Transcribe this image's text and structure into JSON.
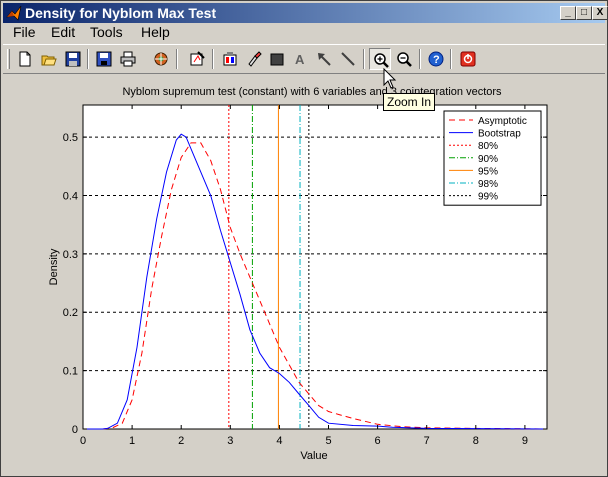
{
  "window": {
    "title": "Density for Nyblom Max Test",
    "controls": {
      "minimize": "_",
      "maximize": "□",
      "close": "X"
    }
  },
  "menu": [
    "File",
    "Edit",
    "Tools",
    "Help"
  ],
  "toolbar": {
    "tools": [
      {
        "name": "new-figure-icon"
      },
      {
        "name": "open-file-icon"
      },
      {
        "name": "save-icon"
      },
      {
        "name": "save-disk-icon"
      },
      {
        "name": "print-icon"
      },
      {
        "name": "plot-tools-icon"
      },
      {
        "name": "edit-plot-icon"
      },
      {
        "name": "insert-colorbar-icon"
      },
      {
        "name": "brush-icon"
      },
      {
        "name": "rectangle-icon"
      },
      {
        "name": "text-a-icon"
      },
      {
        "name": "arrow-icon"
      },
      {
        "name": "line-icon"
      },
      {
        "name": "zoom-in-icon"
      },
      {
        "name": "zoom-out-icon"
      },
      {
        "name": "help-icon"
      },
      {
        "name": "stop-icon"
      }
    ],
    "text_tool_glyph": "A",
    "tooltip": "Zoom In"
  },
  "chart_data": {
    "type": "line",
    "title": "Nyblom supremum test (constant) with 6 variables and 3 cointegration vectors",
    "xlabel": "Value",
    "ylabel": "Density",
    "xlim": [
      0,
      9.45
    ],
    "ylim": [
      0,
      0.555
    ],
    "xticks": [
      0,
      1,
      2,
      3,
      4,
      5,
      6,
      7,
      8,
      9
    ],
    "yticks": [
      0,
      0.1,
      0.2,
      0.3,
      0.4,
      0.5
    ],
    "grid": "y",
    "legend_position": "top-right",
    "series": [
      {
        "name": "Asymptotic",
        "color": "#ff0000",
        "dash": "dashed",
        "points": [
          [
            0,
            0
          ],
          [
            0.4,
            0
          ],
          [
            0.6,
            0.002
          ],
          [
            0.8,
            0.01
          ],
          [
            1.0,
            0.05
          ],
          [
            1.2,
            0.13
          ],
          [
            1.4,
            0.24
          ],
          [
            1.6,
            0.33
          ],
          [
            1.8,
            0.41
          ],
          [
            2.0,
            0.465
          ],
          [
            2.2,
            0.49
          ],
          [
            2.4,
            0.49
          ],
          [
            2.6,
            0.46
          ],
          [
            2.8,
            0.41
          ],
          [
            3.0,
            0.345
          ],
          [
            3.2,
            0.3
          ],
          [
            3.4,
            0.26
          ],
          [
            3.6,
            0.22
          ],
          [
            3.8,
            0.18
          ],
          [
            4.0,
            0.14
          ],
          [
            4.2,
            0.11
          ],
          [
            4.4,
            0.08
          ],
          [
            4.6,
            0.06
          ],
          [
            4.8,
            0.04
          ],
          [
            5.0,
            0.03
          ],
          [
            5.2,
            0.025
          ],
          [
            5.5,
            0.018
          ],
          [
            6.0,
            0.008
          ],
          [
            6.5,
            0.004
          ],
          [
            7.0,
            0.002
          ],
          [
            8.0,
            0.001
          ],
          [
            9.45,
            0
          ]
        ]
      },
      {
        "name": "Bootstrap",
        "color": "#0000ff",
        "dash": "solid",
        "points": [
          [
            0,
            0
          ],
          [
            0.4,
            0
          ],
          [
            0.5,
            0.001
          ],
          [
            0.7,
            0.01
          ],
          [
            0.9,
            0.05
          ],
          [
            1.1,
            0.14
          ],
          [
            1.3,
            0.26
          ],
          [
            1.5,
            0.36
          ],
          [
            1.7,
            0.44
          ],
          [
            1.9,
            0.495
          ],
          [
            2.0,
            0.505
          ],
          [
            2.1,
            0.5
          ],
          [
            2.2,
            0.48
          ],
          [
            2.4,
            0.44
          ],
          [
            2.6,
            0.4
          ],
          [
            2.8,
            0.34
          ],
          [
            3.0,
            0.285
          ],
          [
            3.2,
            0.23
          ],
          [
            3.4,
            0.17
          ],
          [
            3.6,
            0.13
          ],
          [
            3.8,
            0.105
          ],
          [
            4.0,
            0.095
          ],
          [
            4.2,
            0.08
          ],
          [
            4.4,
            0.06
          ],
          [
            4.6,
            0.04
          ],
          [
            4.8,
            0.02
          ],
          [
            5.0,
            0.01
          ],
          [
            5.5,
            0.006
          ],
          [
            6.0,
            0.005
          ],
          [
            6.3,
            0.003
          ],
          [
            7.0,
            0.001
          ],
          [
            9.45,
            0
          ]
        ]
      }
    ],
    "critical_values": [
      {
        "name": "80%",
        "x": 2.97,
        "color": "#ff0000",
        "dash": "2,2"
      },
      {
        "name": "90%",
        "x": 3.45,
        "color": "#00a000",
        "dash": "6,2,1,2"
      },
      {
        "name": "95%",
        "x": 3.98,
        "color": "#ff8000",
        "dash": "none"
      },
      {
        "name": "98%",
        "x": 4.42,
        "color": "#00b0c0",
        "dash": "6,2,1,2"
      },
      {
        "name": "99%",
        "x": 4.6,
        "color": "#000000",
        "dash": "2,2"
      }
    ]
  }
}
